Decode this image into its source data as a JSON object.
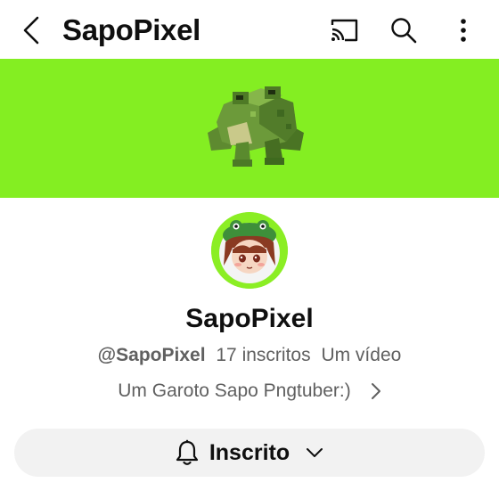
{
  "header": {
    "title": "SapoPixel",
    "icons": {
      "back": "chevron-left-icon",
      "cast": "cast-icon",
      "search": "search-icon",
      "more": "more-vertical-icon"
    }
  },
  "banner": {
    "color": "#84ee22",
    "art": "frog-pixel-art"
  },
  "channel": {
    "name": "SapoPixel",
    "handle": "@SapoPixel",
    "subscribers": "17 inscritos",
    "videos": "Um vídeo",
    "description": "Um Garoto Sapo Pngtuber:)"
  },
  "subscribe": {
    "label": "Inscrito",
    "icon": "bell-icon",
    "dropdown_icon": "chevron-down-icon"
  },
  "colors": {
    "accent_green": "#84ee22",
    "text": "#0f0f0f",
    "secondary_text": "#606060",
    "pill_bg": "#f2f2f2"
  }
}
